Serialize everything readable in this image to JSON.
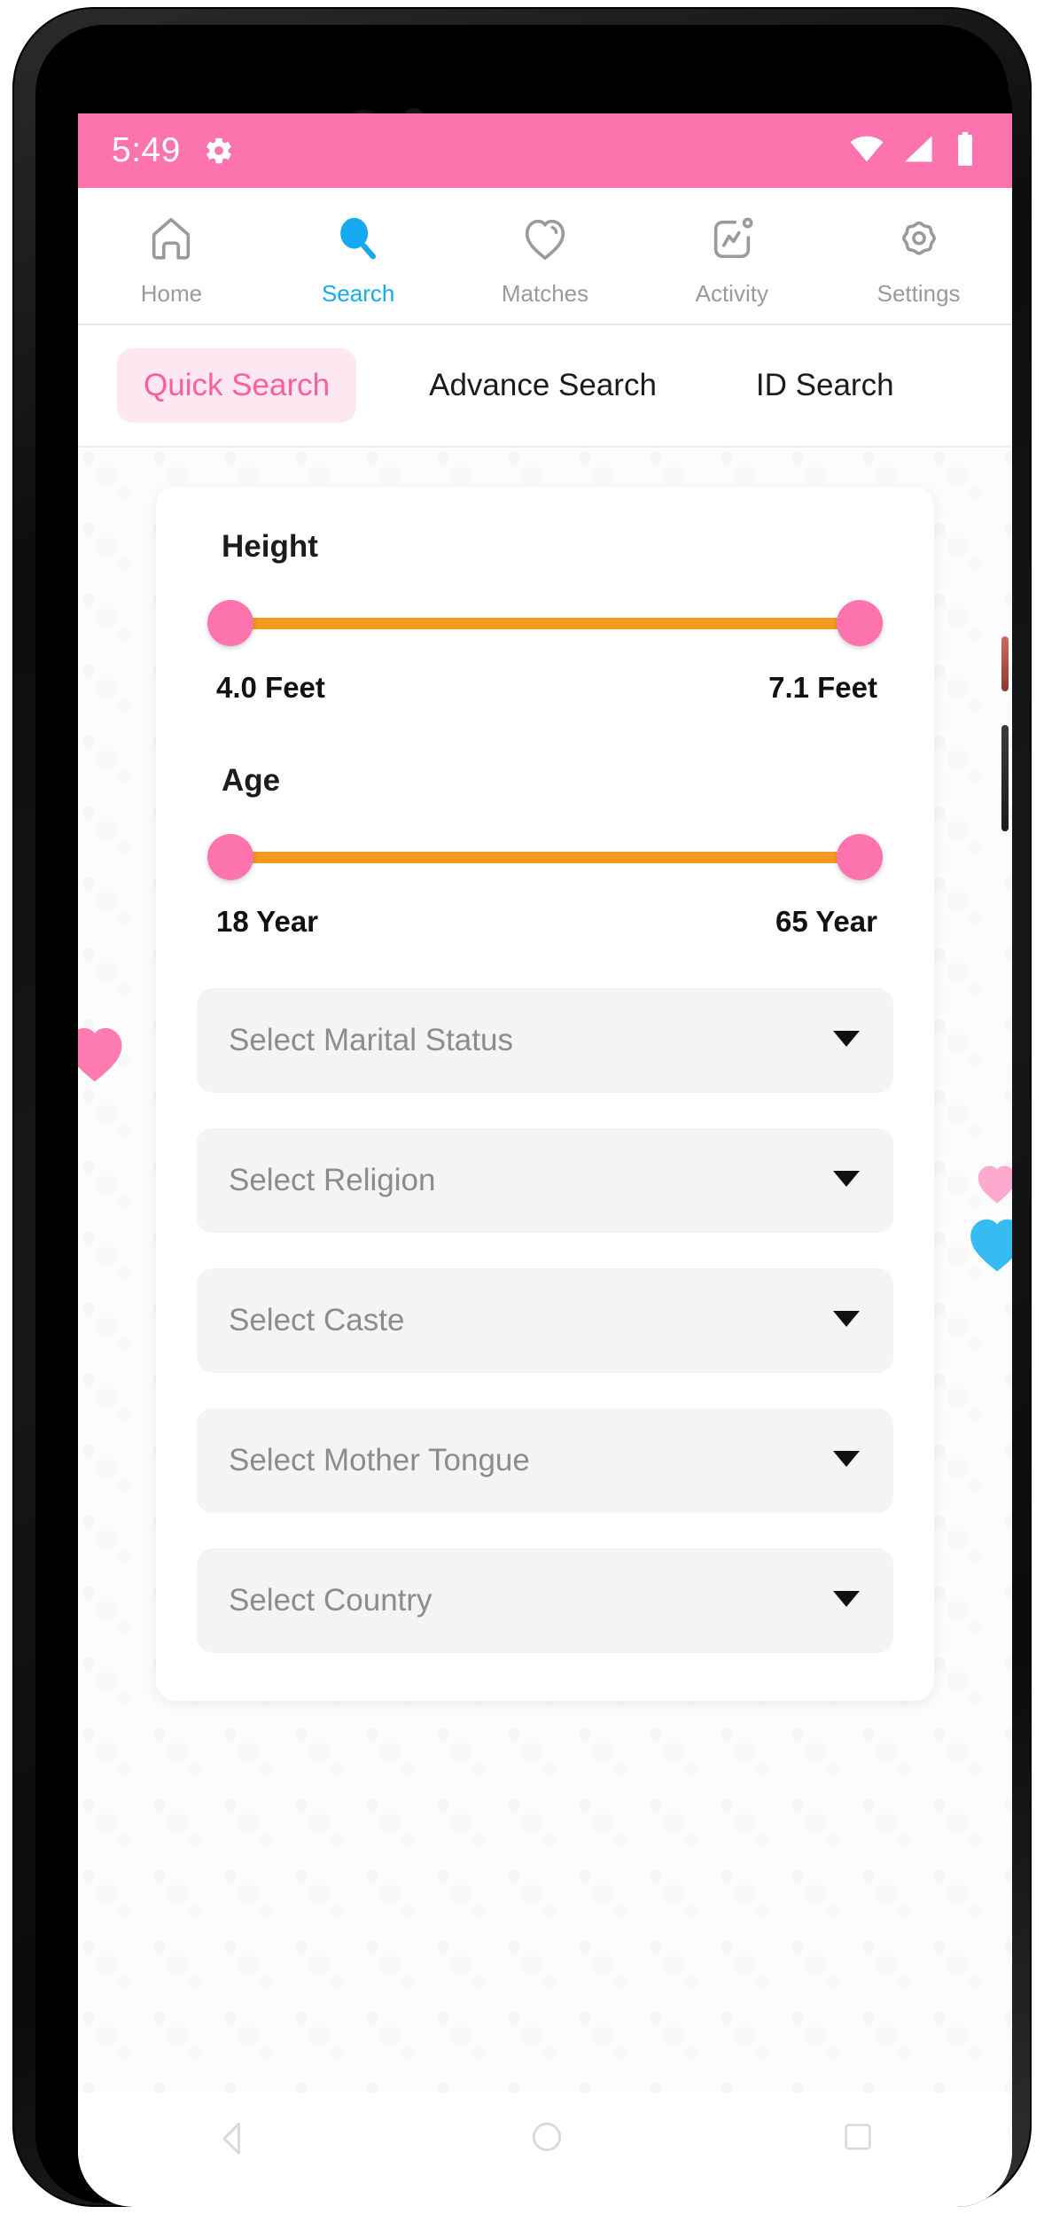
{
  "status_bar": {
    "time": "5:49",
    "gear_icon": "gear-icon",
    "wifi_icon": "wifi-icon",
    "signal_icon": "cellular-signal-icon",
    "battery_icon": "battery-icon",
    "background_color": "#FC73AE"
  },
  "top_nav": {
    "active_index": 1,
    "active_color": "#16A9F0",
    "inactive_color": "#9A9A9A",
    "items": [
      {
        "label": "Home",
        "icon": "home-icon"
      },
      {
        "label": "Search",
        "icon": "search-icon"
      },
      {
        "label": "Matches",
        "icon": "heart-icon"
      },
      {
        "label": "Activity",
        "icon": "activity-chart-icon"
      },
      {
        "label": "Settings",
        "icon": "gear-icon"
      }
    ]
  },
  "search_tabs": {
    "active_index": 0,
    "active_text_color": "#FF5D9E",
    "active_bg_color": "#FDE7F0",
    "items": [
      {
        "label": "Quick Search"
      },
      {
        "label": "Advance Search"
      },
      {
        "label": "ID Search"
      }
    ]
  },
  "filters": {
    "height_slider": {
      "title": "Height",
      "min_label": "4.0 Feet",
      "max_label": "7.1 Feet",
      "track_color": "#F59A20",
      "thumb_color": "#FC73AE"
    },
    "age_slider": {
      "title": "Age",
      "min_label": "18 Year",
      "max_label": "65 Year",
      "track_color": "#F59A20",
      "thumb_color": "#FC73AE"
    },
    "dropdowns": [
      {
        "placeholder": "Select Marital Status",
        "caret": "chevron-down-icon"
      },
      {
        "placeholder": "Select Religion",
        "caret": "chevron-down-icon"
      },
      {
        "placeholder": "Select Caste",
        "caret": "chevron-down-icon"
      },
      {
        "placeholder": "Select Mother Tongue",
        "caret": "chevron-down-icon"
      },
      {
        "placeholder": "Select Country",
        "caret": "chevron-down-icon"
      }
    ]
  },
  "android_nav": {
    "back": "back-triangle-icon",
    "home": "home-circle-icon",
    "recents": "recents-square-icon"
  }
}
